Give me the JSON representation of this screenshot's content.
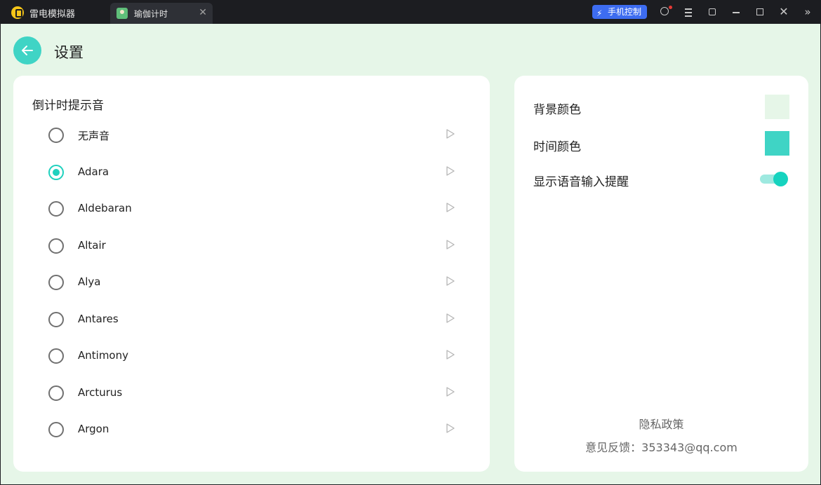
{
  "window": {
    "app_name": "雷电模拟器",
    "tab_title": "瑜伽计时",
    "tab_close": "✕",
    "phone_control_label": "手机控制"
  },
  "header": {
    "title": "设置"
  },
  "countdown_sound": {
    "title": "倒计时提示音",
    "selected": "Adara",
    "items": [
      {
        "label": "无声音",
        "checked": false
      },
      {
        "label": "Adara",
        "checked": true
      },
      {
        "label": "Aldebaran",
        "checked": false
      },
      {
        "label": "Altair",
        "checked": false
      },
      {
        "label": "Alya",
        "checked": false
      },
      {
        "label": "Antares",
        "checked": false
      },
      {
        "label": "Antimony",
        "checked": false
      },
      {
        "label": "Arcturus",
        "checked": false
      },
      {
        "label": "Argon",
        "checked": false
      }
    ]
  },
  "settings": {
    "background_color_label": "背景颜色",
    "background_color": "#e6f6e8",
    "time_color_label": "时间颜色",
    "time_color": "#3fd4c5",
    "voice_reminder_label": "显示语音输入提醒",
    "voice_reminder_on": true
  },
  "footer": {
    "privacy_label": "隐私政策",
    "feedback_label": "意见反馈：353343@qq.com"
  },
  "colors": {
    "accent": "#1fd1be",
    "app_background": "#e6f6e8",
    "titlebar": "#1c1d21",
    "phone_control": "#3d6cf0"
  }
}
